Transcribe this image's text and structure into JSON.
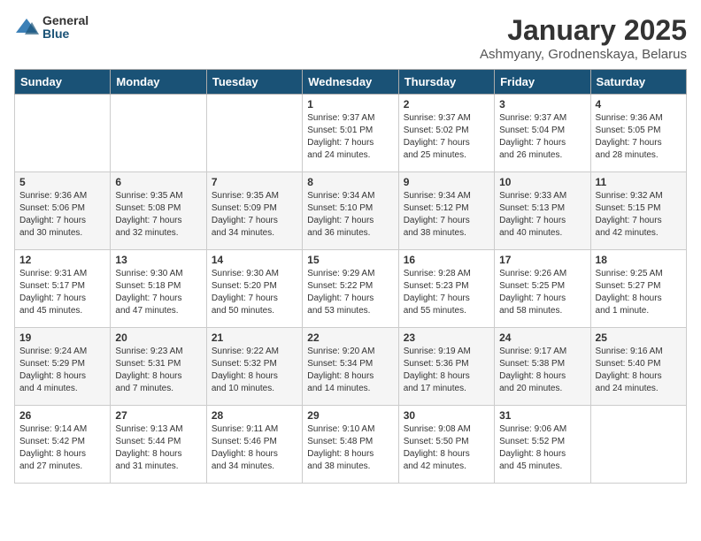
{
  "logo": {
    "general": "General",
    "blue": "Blue"
  },
  "title": "January 2025",
  "subtitle": "Ashmyany, Grodnenskaya, Belarus",
  "days_of_week": [
    "Sunday",
    "Monday",
    "Tuesday",
    "Wednesday",
    "Thursday",
    "Friday",
    "Saturday"
  ],
  "weeks": [
    [
      {
        "day": "",
        "info": ""
      },
      {
        "day": "",
        "info": ""
      },
      {
        "day": "",
        "info": ""
      },
      {
        "day": "1",
        "info": "Sunrise: 9:37 AM\nSunset: 5:01 PM\nDaylight: 7 hours\nand 24 minutes."
      },
      {
        "day": "2",
        "info": "Sunrise: 9:37 AM\nSunset: 5:02 PM\nDaylight: 7 hours\nand 25 minutes."
      },
      {
        "day": "3",
        "info": "Sunrise: 9:37 AM\nSunset: 5:04 PM\nDaylight: 7 hours\nand 26 minutes."
      },
      {
        "day": "4",
        "info": "Sunrise: 9:36 AM\nSunset: 5:05 PM\nDaylight: 7 hours\nand 28 minutes."
      }
    ],
    [
      {
        "day": "5",
        "info": "Sunrise: 9:36 AM\nSunset: 5:06 PM\nDaylight: 7 hours\nand 30 minutes."
      },
      {
        "day": "6",
        "info": "Sunrise: 9:35 AM\nSunset: 5:08 PM\nDaylight: 7 hours\nand 32 minutes."
      },
      {
        "day": "7",
        "info": "Sunrise: 9:35 AM\nSunset: 5:09 PM\nDaylight: 7 hours\nand 34 minutes."
      },
      {
        "day": "8",
        "info": "Sunrise: 9:34 AM\nSunset: 5:10 PM\nDaylight: 7 hours\nand 36 minutes."
      },
      {
        "day": "9",
        "info": "Sunrise: 9:34 AM\nSunset: 5:12 PM\nDaylight: 7 hours\nand 38 minutes."
      },
      {
        "day": "10",
        "info": "Sunrise: 9:33 AM\nSunset: 5:13 PM\nDaylight: 7 hours\nand 40 minutes."
      },
      {
        "day": "11",
        "info": "Sunrise: 9:32 AM\nSunset: 5:15 PM\nDaylight: 7 hours\nand 42 minutes."
      }
    ],
    [
      {
        "day": "12",
        "info": "Sunrise: 9:31 AM\nSunset: 5:17 PM\nDaylight: 7 hours\nand 45 minutes."
      },
      {
        "day": "13",
        "info": "Sunrise: 9:30 AM\nSunset: 5:18 PM\nDaylight: 7 hours\nand 47 minutes."
      },
      {
        "day": "14",
        "info": "Sunrise: 9:30 AM\nSunset: 5:20 PM\nDaylight: 7 hours\nand 50 minutes."
      },
      {
        "day": "15",
        "info": "Sunrise: 9:29 AM\nSunset: 5:22 PM\nDaylight: 7 hours\nand 53 minutes."
      },
      {
        "day": "16",
        "info": "Sunrise: 9:28 AM\nSunset: 5:23 PM\nDaylight: 7 hours\nand 55 minutes."
      },
      {
        "day": "17",
        "info": "Sunrise: 9:26 AM\nSunset: 5:25 PM\nDaylight: 7 hours\nand 58 minutes."
      },
      {
        "day": "18",
        "info": "Sunrise: 9:25 AM\nSunset: 5:27 PM\nDaylight: 8 hours\nand 1 minute."
      }
    ],
    [
      {
        "day": "19",
        "info": "Sunrise: 9:24 AM\nSunset: 5:29 PM\nDaylight: 8 hours\nand 4 minutes."
      },
      {
        "day": "20",
        "info": "Sunrise: 9:23 AM\nSunset: 5:31 PM\nDaylight: 8 hours\nand 7 minutes."
      },
      {
        "day": "21",
        "info": "Sunrise: 9:22 AM\nSunset: 5:32 PM\nDaylight: 8 hours\nand 10 minutes."
      },
      {
        "day": "22",
        "info": "Sunrise: 9:20 AM\nSunset: 5:34 PM\nDaylight: 8 hours\nand 14 minutes."
      },
      {
        "day": "23",
        "info": "Sunrise: 9:19 AM\nSunset: 5:36 PM\nDaylight: 8 hours\nand 17 minutes."
      },
      {
        "day": "24",
        "info": "Sunrise: 9:17 AM\nSunset: 5:38 PM\nDaylight: 8 hours\nand 20 minutes."
      },
      {
        "day": "25",
        "info": "Sunrise: 9:16 AM\nSunset: 5:40 PM\nDaylight: 8 hours\nand 24 minutes."
      }
    ],
    [
      {
        "day": "26",
        "info": "Sunrise: 9:14 AM\nSunset: 5:42 PM\nDaylight: 8 hours\nand 27 minutes."
      },
      {
        "day": "27",
        "info": "Sunrise: 9:13 AM\nSunset: 5:44 PM\nDaylight: 8 hours\nand 31 minutes."
      },
      {
        "day": "28",
        "info": "Sunrise: 9:11 AM\nSunset: 5:46 PM\nDaylight: 8 hours\nand 34 minutes."
      },
      {
        "day": "29",
        "info": "Sunrise: 9:10 AM\nSunset: 5:48 PM\nDaylight: 8 hours\nand 38 minutes."
      },
      {
        "day": "30",
        "info": "Sunrise: 9:08 AM\nSunset: 5:50 PM\nDaylight: 8 hours\nand 42 minutes."
      },
      {
        "day": "31",
        "info": "Sunrise: 9:06 AM\nSunset: 5:52 PM\nDaylight: 8 hours\nand 45 minutes."
      },
      {
        "day": "",
        "info": ""
      }
    ]
  ]
}
